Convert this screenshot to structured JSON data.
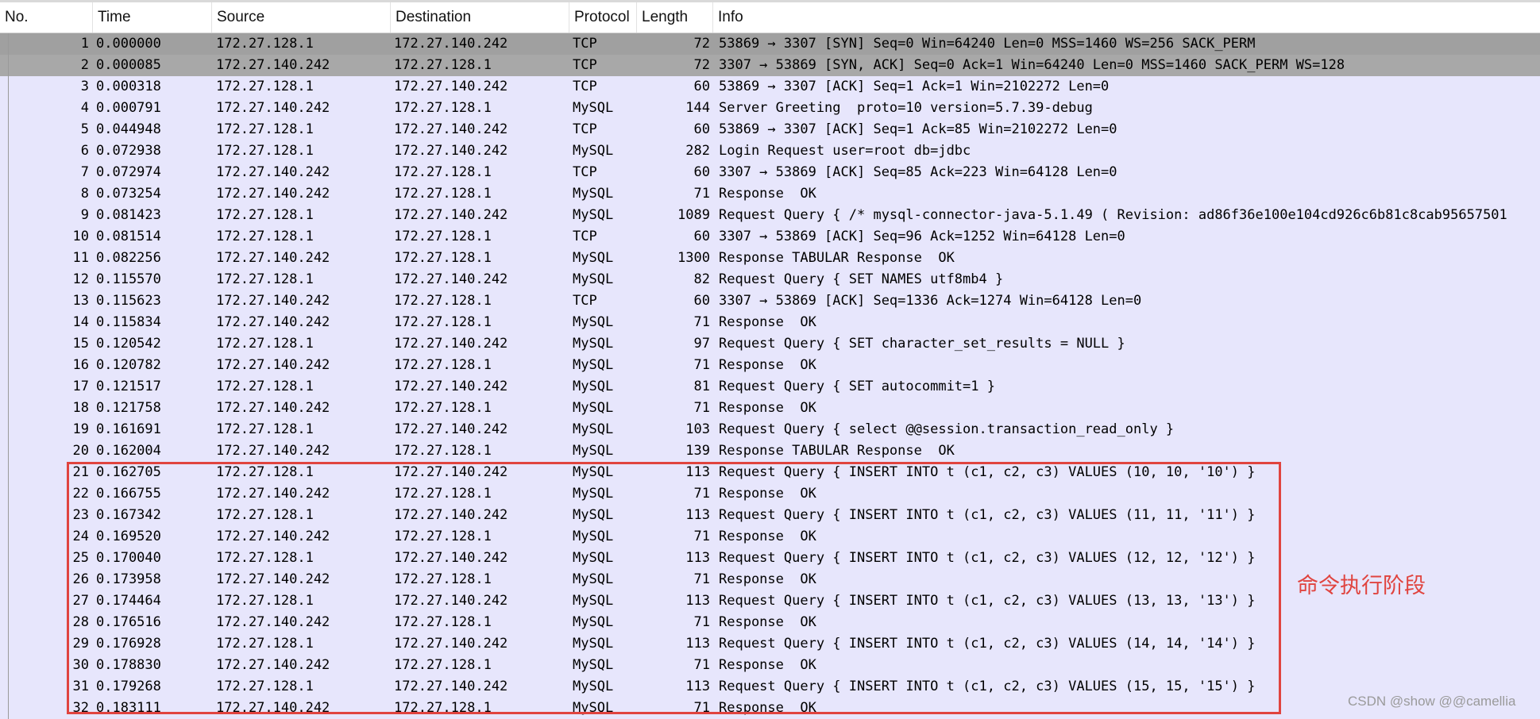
{
  "columns": {
    "no": "No.",
    "time": "Time",
    "source": "Source",
    "destination": "Destination",
    "protocol": "Protocol",
    "length": "Length",
    "info": "Info"
  },
  "packets": [
    {
      "no": "1",
      "time": "0.000000",
      "src": "172.27.128.1",
      "dst": "172.27.140.242",
      "proto": "TCP",
      "len": "72",
      "info": "53869 → 3307 [SYN] Seq=0 Win=64240 Len=0 MSS=1460 WS=256 SACK_PERM"
    },
    {
      "no": "2",
      "time": "0.000085",
      "src": "172.27.140.242",
      "dst": "172.27.128.1",
      "proto": "TCP",
      "len": "72",
      "info": "3307 → 53869 [SYN, ACK] Seq=0 Ack=1 Win=64240 Len=0 MSS=1460 SACK_PERM WS=128"
    },
    {
      "no": "3",
      "time": "0.000318",
      "src": "172.27.128.1",
      "dst": "172.27.140.242",
      "proto": "TCP",
      "len": "60",
      "info": "53869 → 3307 [ACK] Seq=1 Ack=1 Win=2102272 Len=0"
    },
    {
      "no": "4",
      "time": "0.000791",
      "src": "172.27.140.242",
      "dst": "172.27.128.1",
      "proto": "MySQL",
      "len": "144",
      "info": "Server Greeting  proto=10 version=5.7.39-debug"
    },
    {
      "no": "5",
      "time": "0.044948",
      "src": "172.27.128.1",
      "dst": "172.27.140.242",
      "proto": "TCP",
      "len": "60",
      "info": "53869 → 3307 [ACK] Seq=1 Ack=85 Win=2102272 Len=0"
    },
    {
      "no": "6",
      "time": "0.072938",
      "src": "172.27.128.1",
      "dst": "172.27.140.242",
      "proto": "MySQL",
      "len": "282",
      "info": "Login Request user=root db=jdbc"
    },
    {
      "no": "7",
      "time": "0.072974",
      "src": "172.27.140.242",
      "dst": "172.27.128.1",
      "proto": "TCP",
      "len": "60",
      "info": "3307 → 53869 [ACK] Seq=85 Ack=223 Win=64128 Len=0"
    },
    {
      "no": "8",
      "time": "0.073254",
      "src": "172.27.140.242",
      "dst": "172.27.128.1",
      "proto": "MySQL",
      "len": "71",
      "info": "Response  OK"
    },
    {
      "no": "9",
      "time": "0.081423",
      "src": "172.27.128.1",
      "dst": "172.27.140.242",
      "proto": "MySQL",
      "len": "1089",
      "info": "Request Query { /* mysql-connector-java-5.1.49 ( Revision: ad86f36e100e104cd926c6b81c8cab95657501"
    },
    {
      "no": "10",
      "time": "0.081514",
      "src": "172.27.128.1",
      "dst": "172.27.128.1",
      "proto": "TCP",
      "len": "60",
      "info": "3307 → 53869 [ACK] Seq=96 Ack=1252 Win=64128 Len=0"
    },
    {
      "no": "11",
      "time": "0.082256",
      "src": "172.27.140.242",
      "dst": "172.27.128.1",
      "proto": "MySQL",
      "len": "1300",
      "info": "Response TABULAR Response  OK"
    },
    {
      "no": "12",
      "time": "0.115570",
      "src": "172.27.128.1",
      "dst": "172.27.140.242",
      "proto": "MySQL",
      "len": "82",
      "info": "Request Query { SET NAMES utf8mb4 }"
    },
    {
      "no": "13",
      "time": "0.115623",
      "src": "172.27.140.242",
      "dst": "172.27.128.1",
      "proto": "TCP",
      "len": "60",
      "info": "3307 → 53869 [ACK] Seq=1336 Ack=1274 Win=64128 Len=0"
    },
    {
      "no": "14",
      "time": "0.115834",
      "src": "172.27.140.242",
      "dst": "172.27.128.1",
      "proto": "MySQL",
      "len": "71",
      "info": "Response  OK"
    },
    {
      "no": "15",
      "time": "0.120542",
      "src": "172.27.128.1",
      "dst": "172.27.140.242",
      "proto": "MySQL",
      "len": "97",
      "info": "Request Query { SET character_set_results = NULL }"
    },
    {
      "no": "16",
      "time": "0.120782",
      "src": "172.27.140.242",
      "dst": "172.27.128.1",
      "proto": "MySQL",
      "len": "71",
      "info": "Response  OK"
    },
    {
      "no": "17",
      "time": "0.121517",
      "src": "172.27.128.1",
      "dst": "172.27.140.242",
      "proto": "MySQL",
      "len": "81",
      "info": "Request Query { SET autocommit=1 }"
    },
    {
      "no": "18",
      "time": "0.121758",
      "src": "172.27.140.242",
      "dst": "172.27.128.1",
      "proto": "MySQL",
      "len": "71",
      "info": "Response  OK"
    },
    {
      "no": "19",
      "time": "0.161691",
      "src": "172.27.128.1",
      "dst": "172.27.140.242",
      "proto": "MySQL",
      "len": "103",
      "info": "Request Query { select @@session.transaction_read_only }"
    },
    {
      "no": "20",
      "time": "0.162004",
      "src": "172.27.140.242",
      "dst": "172.27.128.1",
      "proto": "MySQL",
      "len": "139",
      "info": "Response TABULAR Response  OK"
    },
    {
      "no": "21",
      "time": "0.162705",
      "src": "172.27.128.1",
      "dst": "172.27.140.242",
      "proto": "MySQL",
      "len": "113",
      "info": "Request Query { INSERT INTO t (c1, c2, c3) VALUES (10, 10, '10') }"
    },
    {
      "no": "22",
      "time": "0.166755",
      "src": "172.27.140.242",
      "dst": "172.27.128.1",
      "proto": "MySQL",
      "len": "71",
      "info": "Response  OK"
    },
    {
      "no": "23",
      "time": "0.167342",
      "src": "172.27.128.1",
      "dst": "172.27.140.242",
      "proto": "MySQL",
      "len": "113",
      "info": "Request Query { INSERT INTO t (c1, c2, c3) VALUES (11, 11, '11') }"
    },
    {
      "no": "24",
      "time": "0.169520",
      "src": "172.27.140.242",
      "dst": "172.27.128.1",
      "proto": "MySQL",
      "len": "71",
      "info": "Response  OK"
    },
    {
      "no": "25",
      "time": "0.170040",
      "src": "172.27.128.1",
      "dst": "172.27.140.242",
      "proto": "MySQL",
      "len": "113",
      "info": "Request Query { INSERT INTO t (c1, c2, c3) VALUES (12, 12, '12') }"
    },
    {
      "no": "26",
      "time": "0.173958",
      "src": "172.27.140.242",
      "dst": "172.27.128.1",
      "proto": "MySQL",
      "len": "71",
      "info": "Response  OK"
    },
    {
      "no": "27",
      "time": "0.174464",
      "src": "172.27.128.1",
      "dst": "172.27.140.242",
      "proto": "MySQL",
      "len": "113",
      "info": "Request Query { INSERT INTO t (c1, c2, c3) VALUES (13, 13, '13') }"
    },
    {
      "no": "28",
      "time": "0.176516",
      "src": "172.27.140.242",
      "dst": "172.27.128.1",
      "proto": "MySQL",
      "len": "71",
      "info": "Response  OK"
    },
    {
      "no": "29",
      "time": "0.176928",
      "src": "172.27.128.1",
      "dst": "172.27.140.242",
      "proto": "MySQL",
      "len": "113",
      "info": "Request Query { INSERT INTO t (c1, c2, c3) VALUES (14, 14, '14') }"
    },
    {
      "no": "30",
      "time": "0.178830",
      "src": "172.27.140.242",
      "dst": "172.27.128.1",
      "proto": "MySQL",
      "len": "71",
      "info": "Response  OK"
    },
    {
      "no": "31",
      "time": "0.179268",
      "src": "172.27.128.1",
      "dst": "172.27.140.242",
      "proto": "MySQL",
      "len": "113",
      "info": "Request Query { INSERT INTO t (c1, c2, c3) VALUES (15, 15, '15') }"
    },
    {
      "no": "32",
      "time": "0.183111",
      "src": "172.27.140.242",
      "dst": "172.27.128.1",
      "proto": "MySQL",
      "len": "71",
      "info": "Response  OK"
    }
  ],
  "annotation": {
    "label": "命令执行阶段",
    "color": "#e0443f"
  },
  "watermark": "CSDN @show @@camellia",
  "colors": {
    "row_bg": "#e7e6fc",
    "selected_bg": "#a0a0a0"
  }
}
